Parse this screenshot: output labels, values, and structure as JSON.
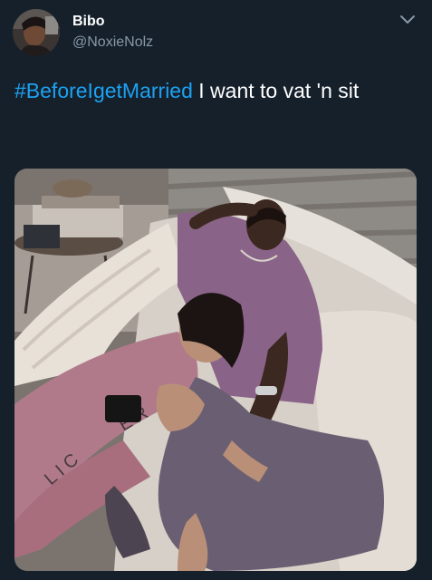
{
  "tweet": {
    "author": {
      "display_name": "Bibo",
      "handle": "@NoxieNolz",
      "avatar_icon": "avatar-photo"
    },
    "text": {
      "hashtag": "#BeforeIgetMarried",
      "body": " I want to vat 'n sit"
    },
    "menu_icon": "chevron-down-icon",
    "media": {
      "type": "photo",
      "lettering": "ERLIC"
    }
  },
  "colors": {
    "background": "#15202b",
    "link": "#1da1f2",
    "secondary_text": "#8899a6"
  }
}
